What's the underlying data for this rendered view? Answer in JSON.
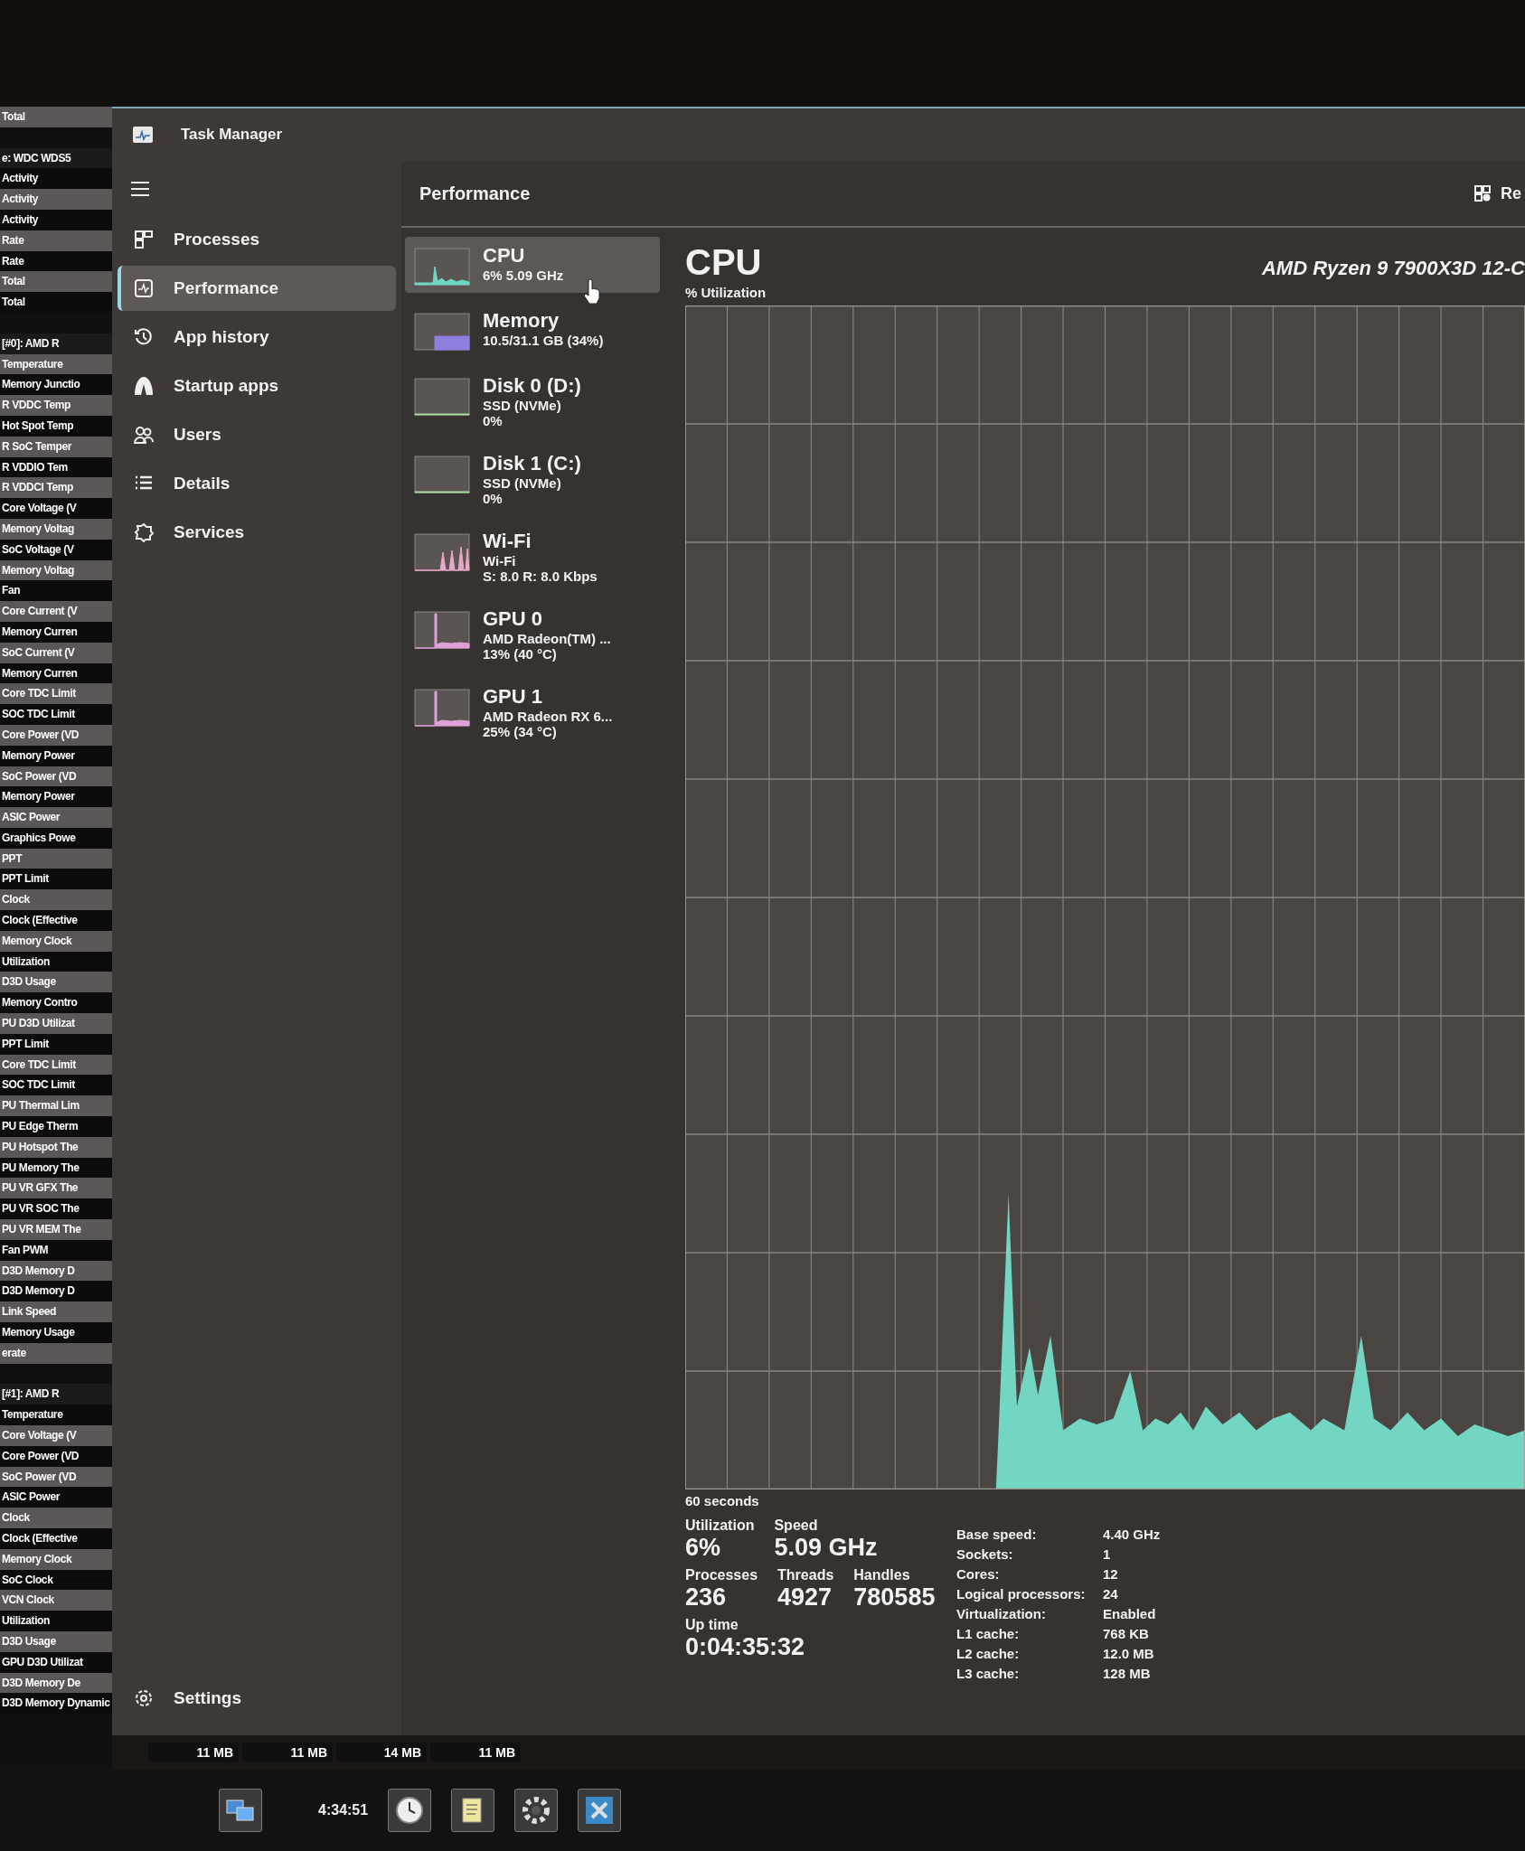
{
  "sensor_list": {
    "rows": [
      {
        "kind": "item",
        "label": "Total"
      },
      {
        "kind": "spacer"
      },
      {
        "kind": "header",
        "label": "e: WDC WDS5"
      },
      {
        "kind": "item",
        "label": "Activity"
      },
      {
        "kind": "item",
        "label": "Activity"
      },
      {
        "kind": "item",
        "label": "Activity"
      },
      {
        "kind": "item",
        "label": "Rate"
      },
      {
        "kind": "item",
        "label": "Rate"
      },
      {
        "kind": "item",
        "label": "Total"
      },
      {
        "kind": "item",
        "label": "Total"
      },
      {
        "kind": "spacer"
      },
      {
        "kind": "header",
        "label": "[#0]: AMD R"
      },
      {
        "kind": "item",
        "label": "Temperature"
      },
      {
        "kind": "item",
        "label": "Memory Junctio"
      },
      {
        "kind": "item",
        "label": "R VDDC Temp"
      },
      {
        "kind": "item",
        "label": "Hot Spot Temp"
      },
      {
        "kind": "item",
        "label": "R SoC Temper"
      },
      {
        "kind": "item",
        "label": "R VDDIO Tem"
      },
      {
        "kind": "item",
        "label": "R VDDCI Temp"
      },
      {
        "kind": "item",
        "label": "Core Voltage (V"
      },
      {
        "kind": "item",
        "label": "Memory Voltag"
      },
      {
        "kind": "item",
        "label": "SoC Voltage (V"
      },
      {
        "kind": "item",
        "label": "Memory Voltag"
      },
      {
        "kind": "item",
        "label": "Fan"
      },
      {
        "kind": "item",
        "label": "Core Current (V"
      },
      {
        "kind": "item",
        "label": "Memory Curren"
      },
      {
        "kind": "item",
        "label": "SoC Current (V"
      },
      {
        "kind": "item",
        "label": "Memory Curren"
      },
      {
        "kind": "item",
        "label": "Core TDC Limit"
      },
      {
        "kind": "item",
        "label": "SOC TDC Limit"
      },
      {
        "kind": "item",
        "label": "Core Power (VD"
      },
      {
        "kind": "item",
        "label": "Memory Power"
      },
      {
        "kind": "item",
        "label": "SoC Power (VD"
      },
      {
        "kind": "item",
        "label": "Memory Power"
      },
      {
        "kind": "item",
        "label": "ASIC Power"
      },
      {
        "kind": "item",
        "label": "Graphics Powe"
      },
      {
        "kind": "item",
        "label": "PPT"
      },
      {
        "kind": "item",
        "label": "PPT Limit"
      },
      {
        "kind": "item",
        "label": "Clock"
      },
      {
        "kind": "item",
        "label": "Clock (Effective"
      },
      {
        "kind": "item",
        "label": "Memory Clock"
      },
      {
        "kind": "item",
        "label": "Utilization"
      },
      {
        "kind": "item",
        "label": "D3D Usage"
      },
      {
        "kind": "item",
        "label": "Memory Contro"
      },
      {
        "kind": "item",
        "label": "PU D3D Utilizat"
      },
      {
        "kind": "item",
        "label": "PPT Limit"
      },
      {
        "kind": "item",
        "label": "Core TDC Limit"
      },
      {
        "kind": "item",
        "label": "SOC TDC Limit"
      },
      {
        "kind": "item",
        "label": "PU Thermal Lim"
      },
      {
        "kind": "item",
        "label": "PU Edge Therm"
      },
      {
        "kind": "item",
        "label": "PU Hotspot The"
      },
      {
        "kind": "item",
        "label": "PU Memory The"
      },
      {
        "kind": "item",
        "label": "PU VR GFX The"
      },
      {
        "kind": "item",
        "label": "PU VR SOC The"
      },
      {
        "kind": "item",
        "label": "PU VR MEM The"
      },
      {
        "kind": "item",
        "label": "Fan PWM"
      },
      {
        "kind": "item",
        "label": "D3D Memory D"
      },
      {
        "kind": "item",
        "label": "D3D Memory D"
      },
      {
        "kind": "item",
        "label": "Link Speed"
      },
      {
        "kind": "item",
        "label": "Memory Usage"
      },
      {
        "kind": "item",
        "label": "erate"
      },
      {
        "kind": "spacer"
      },
      {
        "kind": "header",
        "label": "[#1]: AMD R"
      },
      {
        "kind": "item",
        "label": "Temperature"
      },
      {
        "kind": "item",
        "label": "Core Voltage (V"
      },
      {
        "kind": "item",
        "label": "Core Power (VD"
      },
      {
        "kind": "item",
        "label": "SoC Power (VD"
      },
      {
        "kind": "item",
        "label": "ASIC Power"
      },
      {
        "kind": "item",
        "label": "Clock"
      },
      {
        "kind": "item",
        "label": "Clock (Effective"
      },
      {
        "kind": "item",
        "label": "Memory Clock"
      },
      {
        "kind": "item",
        "label": "SoC Clock"
      },
      {
        "kind": "item",
        "label": "VCN Clock"
      },
      {
        "kind": "item",
        "label": "Utilization"
      },
      {
        "kind": "item",
        "label": "D3D Usage"
      },
      {
        "kind": "item",
        "label": "GPU D3D Utilizat"
      },
      {
        "kind": "item",
        "label": "D3D Memory De"
      },
      {
        "kind": "item",
        "label": "D3D Memory Dynamic"
      }
    ]
  },
  "window": {
    "title": "Task Manager"
  },
  "nav": {
    "items": [
      {
        "label": "Processes",
        "selected": false
      },
      {
        "label": "Performance",
        "selected": true
      },
      {
        "label": "App history",
        "selected": false
      },
      {
        "label": "Startup apps",
        "selected": false
      },
      {
        "label": "Users",
        "selected": false
      },
      {
        "label": "Details",
        "selected": false
      },
      {
        "label": "Services",
        "selected": false
      }
    ],
    "settings": "Settings"
  },
  "performance": {
    "title": "Performance",
    "header_button": "Re",
    "devices": [
      {
        "kind": "cpu",
        "name": "CPU",
        "lines": [
          "6%  5.09 GHz"
        ],
        "color": "#6fd8c4",
        "selected": true
      },
      {
        "kind": "memory",
        "name": "Memory",
        "lines": [
          "10.5/31.1 GB (34%)"
        ],
        "color": "#8e7fe0",
        "selected": false
      },
      {
        "kind": "disk",
        "name": "Disk 0 (D:)",
        "lines": [
          "SSD (NVMe)",
          "0%"
        ],
        "color": "#a8d8a0",
        "selected": false
      },
      {
        "kind": "disk",
        "name": "Disk 1 (C:)",
        "lines": [
          "SSD (NVMe)",
          "0%"
        ],
        "color": "#a8d8a0",
        "selected": false
      },
      {
        "kind": "network",
        "name": "Wi-Fi",
        "lines": [
          "Wi-Fi",
          "S: 8.0 R: 8.0 Kbps"
        ],
        "color": "#e8a8c8",
        "selected": false
      },
      {
        "kind": "gpu",
        "name": "GPU 0",
        "lines": [
          "AMD Radeon(TM) ...",
          "13% (40 °C)"
        ],
        "color": "#e0a0d8",
        "selected": false
      },
      {
        "kind": "gpu",
        "name": "GPU 1",
        "lines": [
          "AMD Radeon RX 6...",
          "25% (34 °C)"
        ],
        "color": "#e0a0d8",
        "selected": false
      }
    ],
    "detail": {
      "title": "CPU",
      "model": "AMD Ryzen 9 7900X3D 12-C",
      "graph_label": "% Utilization",
      "time_span": "60 seconds",
      "stat_rows": [
        [
          {
            "label": "Utilization",
            "value": "6%"
          },
          {
            "label": "Speed",
            "value": "5.09 GHz"
          }
        ],
        [
          {
            "label": "Processes",
            "value": "236"
          },
          {
            "label": "Threads",
            "value": "4927"
          },
          {
            "label": "Handles",
            "value": "780585"
          }
        ],
        [
          {
            "label": "Up time",
            "value": "0:04:35:32"
          }
        ]
      ],
      "specs": [
        {
          "label": "Base speed:",
          "value": "4.40 GHz"
        },
        {
          "label": "Sockets:",
          "value": "1"
        },
        {
          "label": "Cores:",
          "value": "12"
        },
        {
          "label": "Logical processors:",
          "value": "24"
        },
        {
          "label": "Virtualization:",
          "value": "Enabled"
        },
        {
          "label": "L1 cache:",
          "value": "768 KB"
        },
        {
          "label": "L2 cache:",
          "value": "12.0 MB"
        },
        {
          "label": "L3 cache:",
          "value": "128 MB"
        }
      ]
    }
  },
  "bottom_cells": [
    "11 MB",
    "11 MB",
    "14 MB",
    "11 MB"
  ],
  "taskbar": {
    "time": "4:34:51"
  }
}
